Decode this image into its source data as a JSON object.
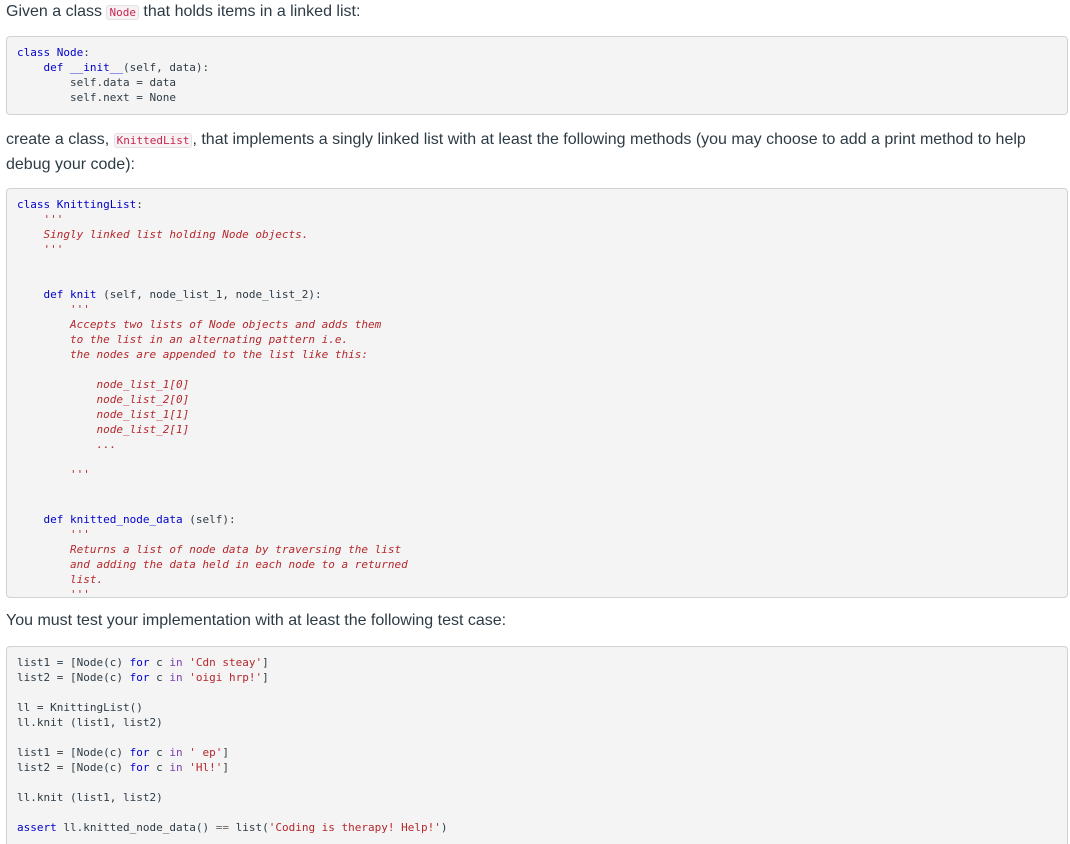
{
  "intro": {
    "before": "Given a class ",
    "code": "Node",
    "after": " that holds items in a linked list:"
  },
  "node_block": {
    "l1_kw": "class",
    "l1_name": "Node",
    "l1_end": ":",
    "l2_kw": "def",
    "l2_name": "__init__",
    "l2_args": "(self, data):",
    "l3": "self.data = data",
    "l4": "self.next = None"
  },
  "task": {
    "before": "create a class, ",
    "code": "KnittedList",
    "after": ", that implements a singly linked list with at least the following methods (you may choose to add a print method to help debug your code):"
  },
  "class_block": {
    "l1_kw": "class",
    "l1_name": "KnittingList",
    "l1_end": ":",
    "quote": "'''",
    "doc1": "Singly linked list holding Node objects.",
    "def_kw": "def",
    "knit_name": "knit",
    "knit_args": " (self, node_list_1, node_list_2):",
    "knit_doc1": "Accepts two lists of Node objects and adds them",
    "knit_doc2": "to the list in an alternating pattern i.e.",
    "knit_doc3": "the nodes are appended to the list like this:",
    "knit_doc4": "node_list_1[0]",
    "knit_doc5": "node_list_2[0]",
    "knit_doc6": "node_list_1[1]",
    "knit_doc7": "node_list_2[1]",
    "knit_doc8": "...",
    "knd_name": "knitted_node_data",
    "knd_args": " (self):",
    "knd_doc1": "Returns a list of node data by traversing the list",
    "knd_doc2": "and adding the data held in each node to a returned",
    "knd_doc3": "list."
  },
  "test_intro": "You must test your implementation with at least the following test case:",
  "test_block": {
    "l1_a": "list1 = [Node(c) ",
    "for": "for",
    "c": " c ",
    "in": "in",
    "l1_s": " 'Cdn steay'",
    "close": "]",
    "l2_a": "list2 = [Node(c) ",
    "l2_s": " 'oigi hrp!'",
    "l3": "ll = KnittingList()",
    "l4": "ll.knit (list1, list2)",
    "l5_a": "list1 = [Node(c) ",
    "l5_s": " ' ep'",
    "l6_a": "list2 = [Node(c) ",
    "l6_s": " 'Hl!'",
    "l7": "ll.knit (list1, list2)",
    "assert_kw": "assert",
    "l8_a": " ll.knitted_node_data() ",
    "l8_op": "==",
    "l8_b": " list(",
    "l8_s": "'Coding is therapy! Help!'",
    "l8_c": ")"
  }
}
